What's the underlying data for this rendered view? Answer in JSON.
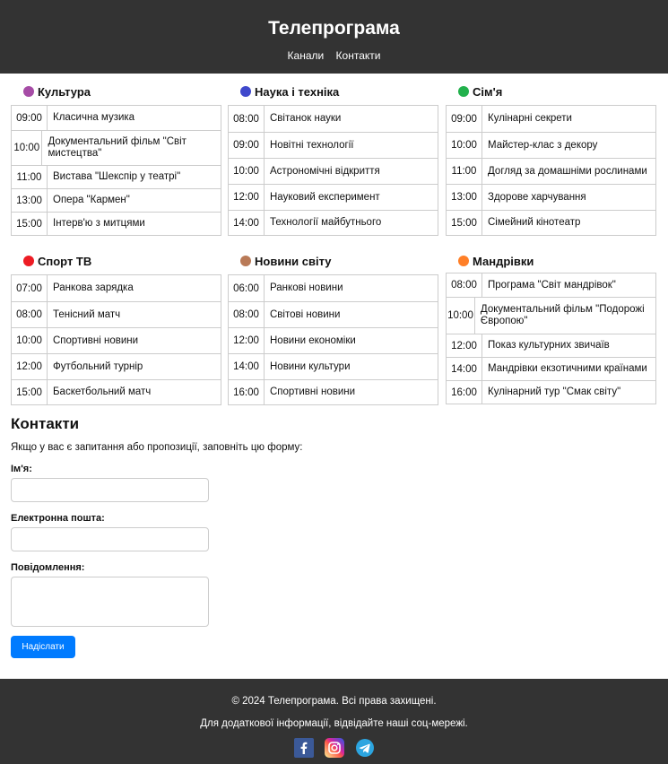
{
  "site": {
    "title": "Телепрограма",
    "nav": [
      "Канали",
      "Контакти"
    ]
  },
  "channels": [
    {
      "name": "Культура",
      "color": "#a64ca6",
      "items": [
        {
          "time": "09:00",
          "title": "Класична музика"
        },
        {
          "time": "10:00",
          "title": "Документальний фільм \"Світ мистецтва\""
        },
        {
          "time": "11:00",
          "title": "Вистава \"Шекспір у театрі\""
        },
        {
          "time": "13:00",
          "title": "Опера \"Кармен\""
        },
        {
          "time": "15:00",
          "title": "Інтерв'ю з митцями"
        }
      ]
    },
    {
      "name": "Наука і техніка",
      "color": "#3f48cc",
      "items": [
        {
          "time": "08:00",
          "title": "Світанок науки"
        },
        {
          "time": "09:00",
          "title": "Новітні технології"
        },
        {
          "time": "10:00",
          "title": "Астрономічні відкриття"
        },
        {
          "time": "12:00",
          "title": "Науковий експеримент"
        },
        {
          "time": "14:00",
          "title": "Технології майбутнього"
        }
      ]
    },
    {
      "name": "Сім'я",
      "color": "#22b14c",
      "items": [
        {
          "time": "09:00",
          "title": "Кулінарні секрети"
        },
        {
          "time": "10:00",
          "title": "Майстер-клас з декору"
        },
        {
          "time": "11:00",
          "title": "Догляд за домашніми рослинами"
        },
        {
          "time": "13:00",
          "title": "Здорове харчування"
        },
        {
          "time": "15:00",
          "title": "Сімейний кінотеатр"
        }
      ]
    },
    {
      "name": "Спорт ТВ",
      "color": "#ed1c24",
      "items": [
        {
          "time": "07:00",
          "title": "Ранкова зарядка"
        },
        {
          "time": "08:00",
          "title": "Тенісний матч"
        },
        {
          "time": "10:00",
          "title": "Спортивні новини"
        },
        {
          "time": "12:00",
          "title": "Футбольний турнір"
        },
        {
          "time": "15:00",
          "title": "Баскетбольний матч"
        }
      ]
    },
    {
      "name": "Новини світу",
      "color": "#b97a57",
      "items": [
        {
          "time": "06:00",
          "title": "Ранкові новини"
        },
        {
          "time": "08:00",
          "title": "Світові новини"
        },
        {
          "time": "12:00",
          "title": "Новини економіки"
        },
        {
          "time": "14:00",
          "title": "Новини культури"
        },
        {
          "time": "16:00",
          "title": "Спортивні новини"
        }
      ]
    },
    {
      "name": "Мандрівки",
      "color": "#ff7f27",
      "items": [
        {
          "time": "08:00",
          "title": "Програма \"Світ мандрівок\""
        },
        {
          "time": "10:00",
          "title": "Документальний фільм \"Подорожі Європою\""
        },
        {
          "time": "12:00",
          "title": "Показ культурних звичаїв"
        },
        {
          "time": "14:00",
          "title": "Мандрівки екзотичними країнами"
        },
        {
          "time": "16:00",
          "title": "Кулінарний тур \"Смак світу\""
        }
      ]
    }
  ],
  "contacts": {
    "heading": "Контакти",
    "intro": "Якщо у вас є запитання або пропозиції, заповніть цю форму:",
    "name_label": "Ім'я:",
    "email_label": "Електронна пошта:",
    "message_label": "Повідомлення:",
    "name_value": "",
    "email_value": "",
    "message_value": "",
    "submit": "Надіслати"
  },
  "footer": {
    "copyright": "© 2024 Телепрограма. Всі права захищені.",
    "social_text": "Для додаткової інформації, відвідайте наші соц-мережі.",
    "socials": [
      {
        "icon": "facebook-icon",
        "color": "#3b5998"
      },
      {
        "icon": "instagram-icon",
        "color": "#d6249f"
      },
      {
        "icon": "telegram-icon",
        "color": "#2ca5e0"
      }
    ]
  }
}
